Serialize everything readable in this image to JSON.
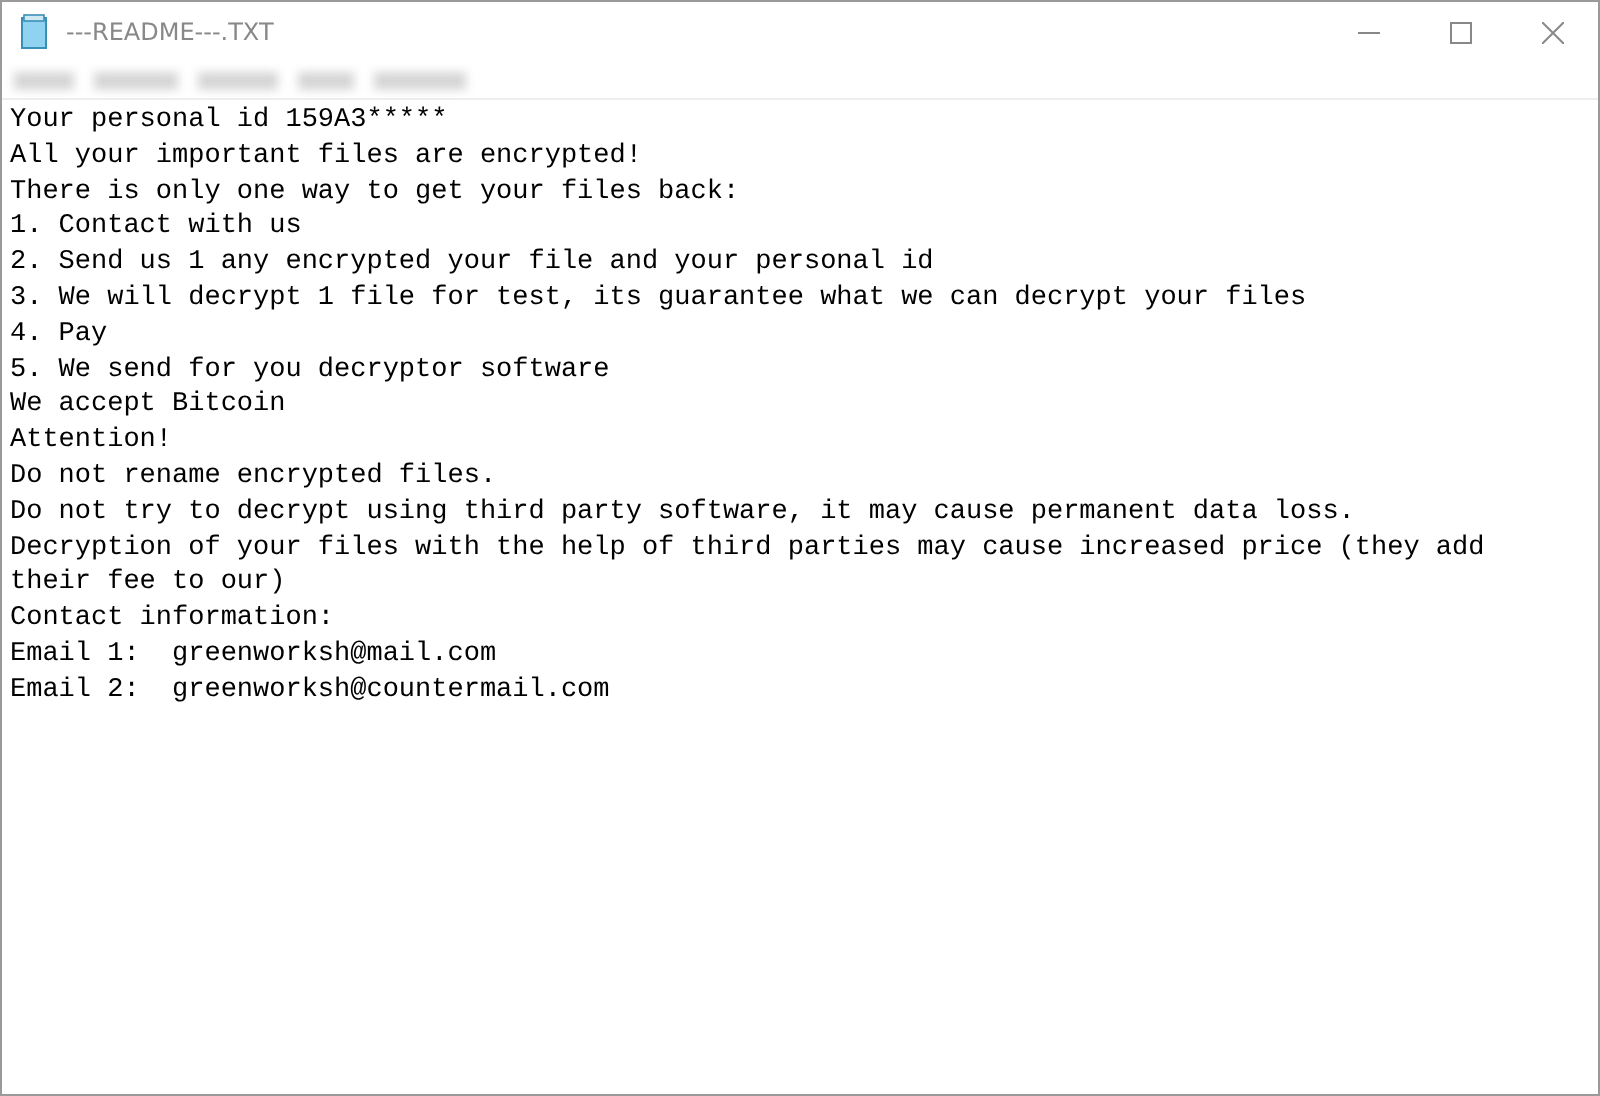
{
  "window": {
    "title": "---README---.TXT"
  },
  "document": {
    "lines": [
      "Your personal id 159A3*****",
      "All your important files are encrypted!",
      "There is only one way to get your files back:",
      "1. Contact with us",
      "2. Send us 1 any encrypted your file and your personal id",
      "3. We will decrypt 1 file for test, its guarantee what we can decrypt your files",
      "4. Pay",
      "5. We send for you decryptor software",
      "We accept Bitcoin",
      "Attention!",
      "Do not rename encrypted files.",
      "Do not try to decrypt using third party software, it may cause permanent data loss.",
      "Decryption of your files with the help of third parties may cause increased price (they add their fee to our)",
      "Contact information:",
      "Email 1:  greenworksh@mail.com",
      "Email 2:  greenworksh@countermail.com"
    ]
  }
}
